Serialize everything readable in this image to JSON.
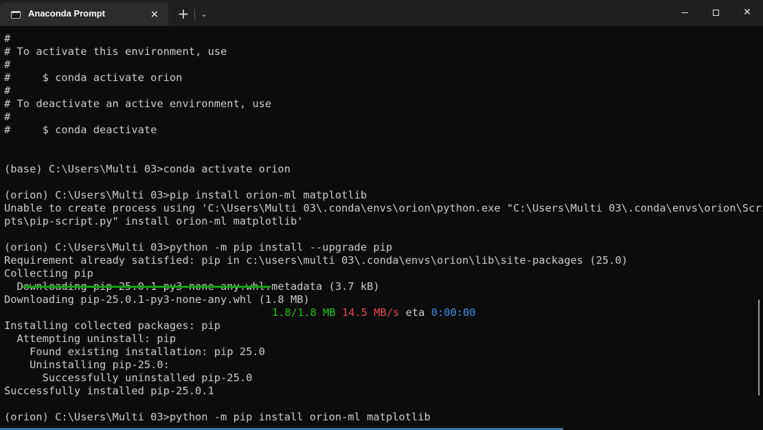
{
  "window": {
    "tab_title": "Anaconda Prompt",
    "tab_close_glyph": "✕",
    "new_tab_glyph": "+",
    "dropdown_glyph": "⌄",
    "close_glyph": "✕"
  },
  "icons": {
    "tab": "terminal-icon",
    "close_tab": "close-icon",
    "new_tab": "plus-icon",
    "dropdown": "chevron-down-icon",
    "minimize": "minimize-icon",
    "maximize": "maximize-icon",
    "close_window": "close-icon"
  },
  "colors": {
    "background": "#0c0c0c",
    "text": "#cccccc",
    "progress_green": "#16c60c",
    "speed_red": "#e74856",
    "eta_cyan": "#3b8eea"
  },
  "terminal": {
    "lines": [
      "#",
      "# To activate this environment, use",
      "#",
      "#     $ conda activate orion",
      "#",
      "# To deactivate an active environment, use",
      "#",
      "#     $ conda deactivate",
      "",
      "",
      "(base) C:\\Users\\Multi 03>conda activate orion",
      "",
      "(orion) C:\\Users\\Multi 03>pip install orion-ml matplotlib",
      "Unable to create process using 'C:\\Users\\Multi 03\\.conda\\envs\\orion\\python.exe \"C:\\Users\\Multi 03\\.conda\\envs\\orion\\Scri",
      "pts\\pip-script.py\" install orion-ml matplotlib'",
      "",
      "(orion) C:\\Users\\Multi 03>python -m pip install --upgrade pip",
      "Requirement already satisfied: pip in c:\\users\\multi 03\\.conda\\envs\\orion\\lib\\site-packages (25.0)",
      "Collecting pip",
      "  Downloading pip-25.0.1-py3-none-any.whl.metadata (3.7 kB)",
      "Downloading pip-25.0.1-py3-none-any.whl (1.8 MB)"
    ],
    "progress": {
      "fraction": 1.0,
      "size": "1.8/1.8 MB",
      "speed": "14.5 MB/s",
      "eta_label": "eta",
      "eta_value": "0:00:00"
    },
    "lines_after": [
      "Installing collected packages: pip",
      "  Attempting uninstall: pip",
      "    Found existing installation: pip 25.0",
      "    Uninstalling pip-25.0:",
      "      Successfully uninstalled pip-25.0",
      "Successfully installed pip-25.0.1",
      "",
      "(orion) C:\\Users\\Multi 03>python -m pip install orion-ml matplotlib"
    ]
  }
}
